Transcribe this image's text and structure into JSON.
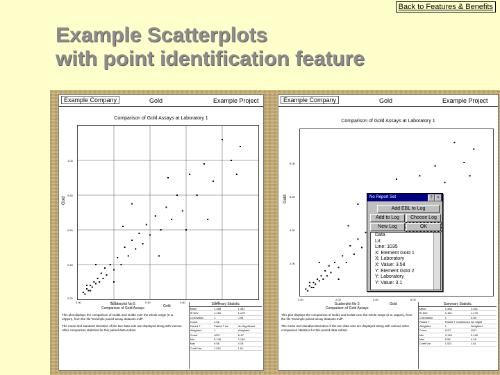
{
  "nav": {
    "back_label": "Back to Features & Benefits"
  },
  "title": {
    "line1": "Example Scatterplots",
    "line2": "with point identification feature"
  },
  "left": {
    "company": "Example Company",
    "element": "Gold",
    "project": "Example Project",
    "plot_title": "Comparison of Gold Assays at Laboratory 1",
    "ylabel": "Gold",
    "xlabel": "Gold",
    "yticks": [
      "1.00",
      "0.80",
      "0.60",
      "0.40",
      "0.20"
    ],
    "xticks": [
      "0.00",
      "0.20",
      "0.40",
      "0.60",
      "0.80"
    ],
    "stats_title": "Scatterplot No 5",
    "stats_sub": "Comparison of Gold Assays",
    "para1": "This plot displays the comparison of Gold1 and Gold2 over the whole range (0 to 10ppm), from the file \"Example paired assay datasets.mdf\".",
    "para2": "The mean and standard deviation of the two data sets are displayed along with various other comparison statistics for this paired data subset.",
    "summary_title": "Summary Statistic",
    "summary_rows": [
      [
        "Mean",
        "1.488",
        "1.481"
      ],
      [
        "St Dev",
        "1.181",
        "1.175"
      ],
      [
        "Correlation",
        "1",
        "0.98"
      ],
      [
        "Count",
        "1.56",
        ""
      ],
      [
        "Paired T",
        "Paired T for",
        "No Significant"
      ],
      [
        "Weighted",
        "1",
        "Weighted"
      ],
      [
        "Count",
        "1037",
        "1107"
      ],
      [
        "Min",
        "0.145",
        "0.145"
      ],
      [
        "Max",
        "9.56",
        "4.18"
      ],
      [
        "Coeff Var",
        "1.521",
        "1.61"
      ]
    ]
  },
  "right": {
    "company": "Example Company",
    "element": "Gold",
    "project": "Example Project",
    "plot_title": "Comparison of Gold Assays at Laboratory 1",
    "ylabel": "Gold",
    "xlabel": "Gold",
    "yticks": [
      "8.00",
      "6.00",
      "4.00",
      "2.00"
    ],
    "xticks": [
      "0.00",
      "2.00",
      "4.00",
      "6.00"
    ],
    "stats_title": "Scatterplot No 5",
    "stats_sub": "Comparison of Gold Assays",
    "para1": "This plot displays the comparison of Gold1 and Gold2 over the whole range (0 to 10ppm), from the file \"Example paired assay datasets.mdf\".",
    "para2": "The mean and standard deviation of the two data sets are displayed along with various other comparison statistics for this paired data subset.",
    "summary_title": "Summary Statistic",
    "summary_rows": [
      [
        "Mean",
        "1.488",
        "1.481"
      ],
      [
        "St Dev",
        "1.181",
        "1.175"
      ],
      [
        "Correlation",
        "1",
        "0.98"
      ],
      [
        "Paired T",
        "Paired T Confidence",
        "No Signif"
      ],
      [
        "Weighted",
        "1",
        "Weighted"
      ],
      [
        "Count",
        "1137",
        "1107"
      ],
      [
        "Min",
        "0.145",
        "0.145"
      ],
      [
        "Max",
        "9.56",
        "4.18"
      ],
      [
        "Coeff Var",
        "1.521",
        "1.61"
      ]
    ]
  },
  "dialog": {
    "title": "No Report Set",
    "help": "?",
    "close": "×",
    "btn_add_ebl": "Add EBL to Log",
    "btn_add_log": "Add to Log",
    "btn_choose_log": "Choose Log",
    "btn_new_log": "New Log",
    "btn_ok": "OK",
    "list": [
      "Data",
      "Lit",
      "Line: 1035",
      "X: Element Gold 1",
      "X: Laboratory",
      "X: Value: 3.58",
      "Y: Element Gold 2",
      "Y: Laboratory",
      "Y: Value: 3.1"
    ]
  },
  "chart_data": [
    {
      "type": "scatter",
      "title": "Comparison of Gold Assays at Laboratory 1",
      "xlabel": "Gold",
      "ylabel": "Gold",
      "xlim": [
        0,
        10
      ],
      "ylim": [
        0,
        10
      ],
      "grid": true,
      "points": [
        [
          0.3,
          0.4
        ],
        [
          0.4,
          0.3
        ],
        [
          0.5,
          0.6
        ],
        [
          0.6,
          0.5
        ],
        [
          0.7,
          0.8
        ],
        [
          0.8,
          0.7
        ],
        [
          0.9,
          1.0
        ],
        [
          1.0,
          0.9
        ],
        [
          1.1,
          1.2
        ],
        [
          1.2,
          1.0
        ],
        [
          0.5,
          0.8
        ],
        [
          0.7,
          0.5
        ],
        [
          1.3,
          1.5
        ],
        [
          1.4,
          1.2
        ],
        [
          1.5,
          1.8
        ],
        [
          1.6,
          1.4
        ],
        [
          1.8,
          2.0
        ],
        [
          2.0,
          1.7
        ],
        [
          2.2,
          2.4
        ],
        [
          2.4,
          2.0
        ],
        [
          2.6,
          3.0
        ],
        [
          2.8,
          2.5
        ],
        [
          3.0,
          3.4
        ],
        [
          3.2,
          2.9
        ],
        [
          3.4,
          3.8
        ],
        [
          3.6,
          3.2
        ],
        [
          3.8,
          4.3
        ],
        [
          4.0,
          3.7
        ],
        [
          4.3,
          4.8
        ],
        [
          4.6,
          4.0
        ],
        [
          4.9,
          5.3
        ],
        [
          5.2,
          4.6
        ],
        [
          5.5,
          6.0
        ],
        [
          5.8,
          5.1
        ],
        [
          6.2,
          7.2
        ],
        [
          6.6,
          6.0
        ],
        [
          7.0,
          7.8
        ],
        [
          7.5,
          6.8
        ],
        [
          8.0,
          9.2
        ],
        [
          8.5,
          8.0
        ],
        [
          9.0,
          8.8
        ],
        [
          3.0,
          5.5
        ],
        [
          2.5,
          4.2
        ],
        [
          4.5,
          2.5
        ],
        [
          6.0,
          4.0
        ],
        [
          7.2,
          4.6
        ],
        [
          8.8,
          7.2
        ],
        [
          1.0,
          2.0
        ],
        [
          2.0,
          1.0
        ],
        [
          5.0,
          7.0
        ]
      ]
    },
    {
      "type": "scatter",
      "title": "Comparison of Gold Assays at Laboratory 1",
      "xlabel": "Gold",
      "ylabel": "Gold",
      "xlim": [
        0,
        10
      ],
      "ylim": [
        0,
        10
      ],
      "grid": false,
      "points": [
        [
          0.3,
          0.4
        ],
        [
          0.4,
          0.3
        ],
        [
          0.5,
          0.6
        ],
        [
          0.6,
          0.5
        ],
        [
          0.7,
          0.8
        ],
        [
          0.8,
          0.7
        ],
        [
          0.9,
          1.0
        ],
        [
          1.0,
          0.9
        ],
        [
          1.1,
          1.2
        ],
        [
          1.2,
          1.0
        ],
        [
          0.5,
          0.8
        ],
        [
          0.7,
          0.5
        ],
        [
          1.3,
          1.5
        ],
        [
          1.4,
          1.2
        ],
        [
          1.5,
          1.8
        ],
        [
          1.6,
          1.4
        ],
        [
          1.8,
          2.0
        ],
        [
          2.0,
          1.7
        ],
        [
          2.2,
          2.4
        ],
        [
          2.4,
          2.0
        ],
        [
          2.6,
          3.0
        ],
        [
          2.8,
          2.5
        ],
        [
          3.0,
          3.4
        ],
        [
          3.2,
          2.9
        ],
        [
          3.4,
          3.8
        ],
        [
          3.6,
          3.2
        ],
        [
          3.8,
          4.3
        ],
        [
          4.0,
          3.7
        ],
        [
          4.3,
          4.8
        ],
        [
          4.6,
          4.0
        ],
        [
          4.9,
          5.3
        ],
        [
          5.2,
          4.6
        ],
        [
          5.5,
          6.0
        ],
        [
          5.8,
          5.1
        ],
        [
          6.2,
          7.2
        ],
        [
          6.6,
          6.0
        ],
        [
          7.0,
          7.8
        ],
        [
          7.5,
          6.8
        ],
        [
          8.0,
          9.2
        ],
        [
          8.5,
          8.0
        ],
        [
          9.0,
          8.8
        ],
        [
          3.0,
          5.5
        ],
        [
          2.5,
          4.2
        ],
        [
          4.5,
          2.5
        ],
        [
          6.0,
          4.0
        ],
        [
          7.2,
          4.6
        ],
        [
          8.8,
          7.2
        ],
        [
          1.0,
          2.0
        ],
        [
          2.0,
          1.0
        ],
        [
          5.0,
          7.0
        ]
      ]
    }
  ]
}
